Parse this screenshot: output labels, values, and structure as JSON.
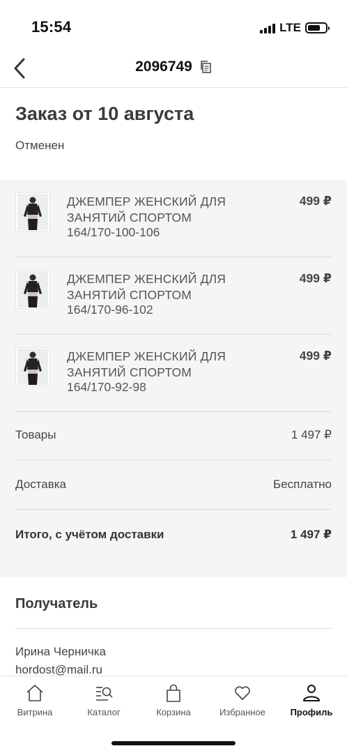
{
  "status_bar": {
    "time": "15:54",
    "network": "LTE"
  },
  "header": {
    "title": "2096749"
  },
  "order": {
    "title": "Заказ от 10 августа",
    "status": "Отменен"
  },
  "items": [
    {
      "name": "ДЖЕМПЕР ЖЕНСКИЙ ДЛЯ ЗАНЯТИЙ СПОРТОМ",
      "size": "164/170-100-106",
      "price": "499 ₽"
    },
    {
      "name": "ДЖЕМПЕР ЖЕНСКИЙ ДЛЯ ЗАНЯТИЙ СПОРТОМ",
      "size": "164/170-96-102",
      "price": "499 ₽"
    },
    {
      "name": "ДЖЕМПЕР ЖЕНСКИЙ ДЛЯ ЗАНЯТИЙ СПОРТОМ",
      "size": "164/170-92-98",
      "price": "499 ₽"
    }
  ],
  "summary": {
    "goods_label": "Товары",
    "goods_value": "1 497 ₽",
    "delivery_label": "Доставка",
    "delivery_value": "Бесплатно",
    "total_label": "Итого, с учётом доставки",
    "total_value": "1 497 ₽"
  },
  "recipient": {
    "title": "Получатель",
    "name": "Ирина Черничка",
    "email": "hordost@mail.ru"
  },
  "tabs": [
    {
      "label": "Витрина",
      "icon": "home-icon"
    },
    {
      "label": "Каталог",
      "icon": "catalog-search-icon"
    },
    {
      "label": "Корзина",
      "icon": "bag-icon"
    },
    {
      "label": "Избранное",
      "icon": "heart-icon"
    },
    {
      "label": "Профиль",
      "icon": "profile-icon",
      "active": true
    }
  ]
}
